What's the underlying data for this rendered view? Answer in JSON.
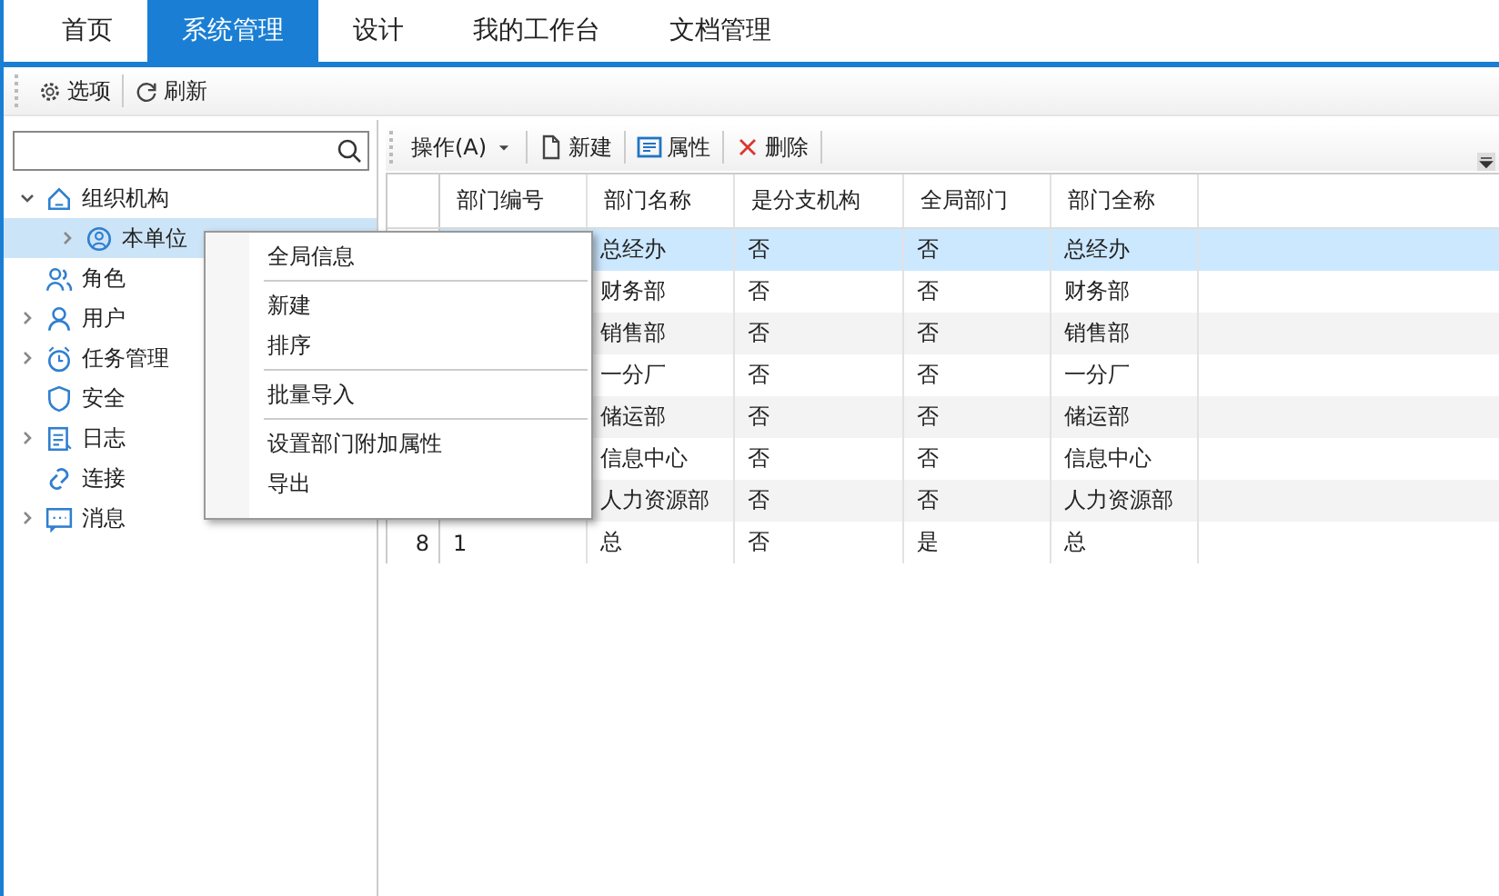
{
  "tabs": [
    {
      "label": "首页",
      "selected": false
    },
    {
      "label": "系统管理",
      "selected": true
    },
    {
      "label": "设计",
      "selected": false
    },
    {
      "label": "我的工作台",
      "selected": false
    },
    {
      "label": "文档管理",
      "selected": false
    }
  ],
  "toolbar": [
    {
      "label": "选项"
    },
    {
      "label": "刷新"
    }
  ],
  "tree": [
    {
      "label": "组织机构",
      "expandable": true,
      "expanded": true,
      "selected": false,
      "children": [
        {
          "label": "本单位",
          "expandable": true,
          "expanded": false,
          "selected": true
        }
      ]
    },
    {
      "label": "角色",
      "expandable": false,
      "selected": false
    },
    {
      "label": "用户",
      "expandable": true,
      "expanded": false,
      "selected": false
    },
    {
      "label": "任务管理",
      "expandable": true,
      "expanded": false,
      "selected": false
    },
    {
      "label": "安全",
      "expandable": false,
      "selected": false
    },
    {
      "label": "日志",
      "expandable": true,
      "expanded": false,
      "selected": false
    },
    {
      "label": "连接",
      "expandable": false,
      "selected": false
    },
    {
      "label": "消息",
      "expandable": true,
      "expanded": false,
      "selected": false
    }
  ],
  "grid_toolbar": [
    {
      "kind": "dropdown",
      "label": "操作(A)"
    },
    {
      "kind": "button",
      "label": "新建"
    },
    {
      "kind": "button",
      "label": "属性"
    },
    {
      "kind": "button",
      "label": "删除"
    }
  ],
  "table": {
    "columns": [
      "",
      "部门编号",
      "部门名称",
      "是分支机构",
      "全局部门",
      "部门全称"
    ],
    "rows": [
      {
        "selected": true,
        "cells": [
          "",
          "",
          "总经办",
          "否",
          "否",
          "总经办"
        ]
      },
      {
        "selected": false,
        "cells": [
          "",
          "",
          "财务部",
          "否",
          "否",
          "财务部"
        ]
      },
      {
        "selected": false,
        "cells": [
          "",
          "",
          "销售部",
          "否",
          "否",
          "销售部"
        ]
      },
      {
        "selected": false,
        "cells": [
          "",
          "",
          "一分厂",
          "否",
          "否",
          "一分厂"
        ]
      },
      {
        "selected": false,
        "cells": [
          "",
          "",
          "储运部",
          "否",
          "否",
          "储运部"
        ]
      },
      {
        "selected": false,
        "cells": [
          "",
          "",
          "信息中心",
          "否",
          "否",
          "信息中心"
        ]
      },
      {
        "selected": false,
        "cells": [
          "",
          "",
          "人力资源部",
          "否",
          "否",
          "人力资源部"
        ]
      },
      {
        "selected": false,
        "cells": [
          "8",
          "1",
          "总",
          "否",
          "是",
          "总"
        ]
      }
    ]
  },
  "context_menu": {
    "groups": [
      [
        "全局信息"
      ],
      [
        "新建",
        "排序"
      ],
      [
        "批量导入"
      ],
      [
        "设置部门附加属性",
        "导出"
      ]
    ]
  }
}
